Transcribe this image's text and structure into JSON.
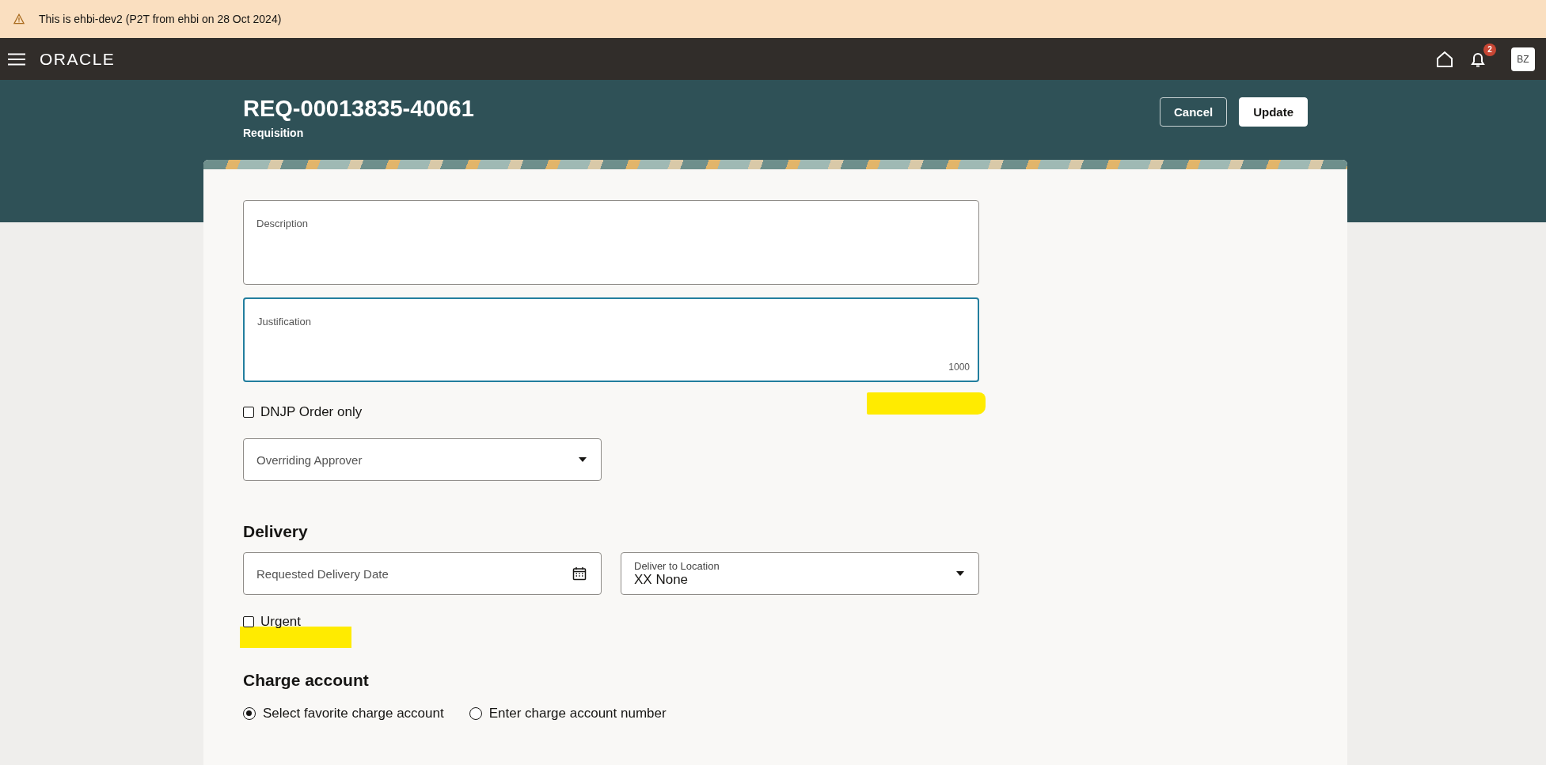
{
  "banner": {
    "text": "This is ehbi-dev2 (P2T from ehbi on 28 Oct 2024)"
  },
  "navbar": {
    "logo": "ORACLE",
    "notification_count": "2",
    "avatar": "BZ"
  },
  "header": {
    "title": "REQ-00013835-40061",
    "subtitle": "Requisition",
    "buttons": [
      {
        "label": "Cancel",
        "kind": "secondary"
      },
      {
        "label": "Update",
        "kind": "primary"
      }
    ]
  },
  "form": {
    "text_areas": [
      {
        "label": "Description",
        "focused": false
      },
      {
        "label": "Justification",
        "focused": true,
        "counter": "1000"
      }
    ],
    "dnjp_checkbox": {
      "label": "DNJP Order only",
      "checked": false
    },
    "overriding_approver": {
      "label": "Overriding Approver"
    },
    "delivery": {
      "heading": "Delivery",
      "date_field": {
        "label": "Requested Delivery Date"
      },
      "location_field": {
        "label": "Deliver to Location",
        "value": "XX None"
      },
      "urgent_checkbox": {
        "label": "Urgent",
        "checked": false
      }
    },
    "charge_account": {
      "heading": "Charge account",
      "options": [
        {
          "label": "Select favorite charge account",
          "selected": true
        },
        {
          "label": "Enter charge account number",
          "selected": false
        }
      ]
    }
  }
}
